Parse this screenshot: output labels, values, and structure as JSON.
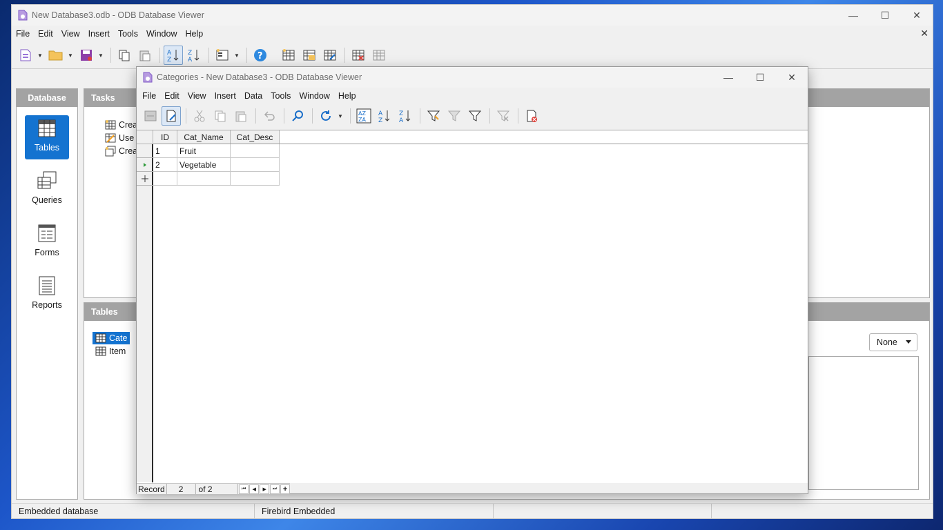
{
  "main_window": {
    "title": "New Database3.odb - ODB Database Viewer",
    "menu": [
      "File",
      "Edit",
      "View",
      "Insert",
      "Tools",
      "Window",
      "Help"
    ]
  },
  "database_pane": {
    "header": "Database",
    "items": [
      {
        "label": "Tables",
        "selected": true
      },
      {
        "label": "Queries",
        "selected": false
      },
      {
        "label": "Forms",
        "selected": false
      },
      {
        "label": "Reports",
        "selected": false
      }
    ]
  },
  "tasks_pane": {
    "header": "Tasks",
    "items": [
      "Crea",
      "Use",
      "Crea"
    ]
  },
  "tables_pane": {
    "header": "Tables",
    "items": [
      "Cate",
      "Item"
    ],
    "preview_select": "None"
  },
  "statusbar": {
    "left": "Embedded database",
    "middle": "Firebird Embedded"
  },
  "table_window": {
    "title": "Categories - New Database3 - ODB Database Viewer",
    "menu": [
      "File",
      "Edit",
      "View",
      "Insert",
      "Data",
      "Tools",
      "Window",
      "Help"
    ],
    "columns": [
      "ID",
      "Cat_Name",
      "Cat_Desc"
    ],
    "rows": [
      {
        "id": "1",
        "name": "Fruit",
        "desc": ""
      },
      {
        "id": "2",
        "name": "Vegetable",
        "desc": ""
      }
    ],
    "navbar": {
      "label": "Record",
      "current": "2",
      "of": "of 2"
    }
  }
}
